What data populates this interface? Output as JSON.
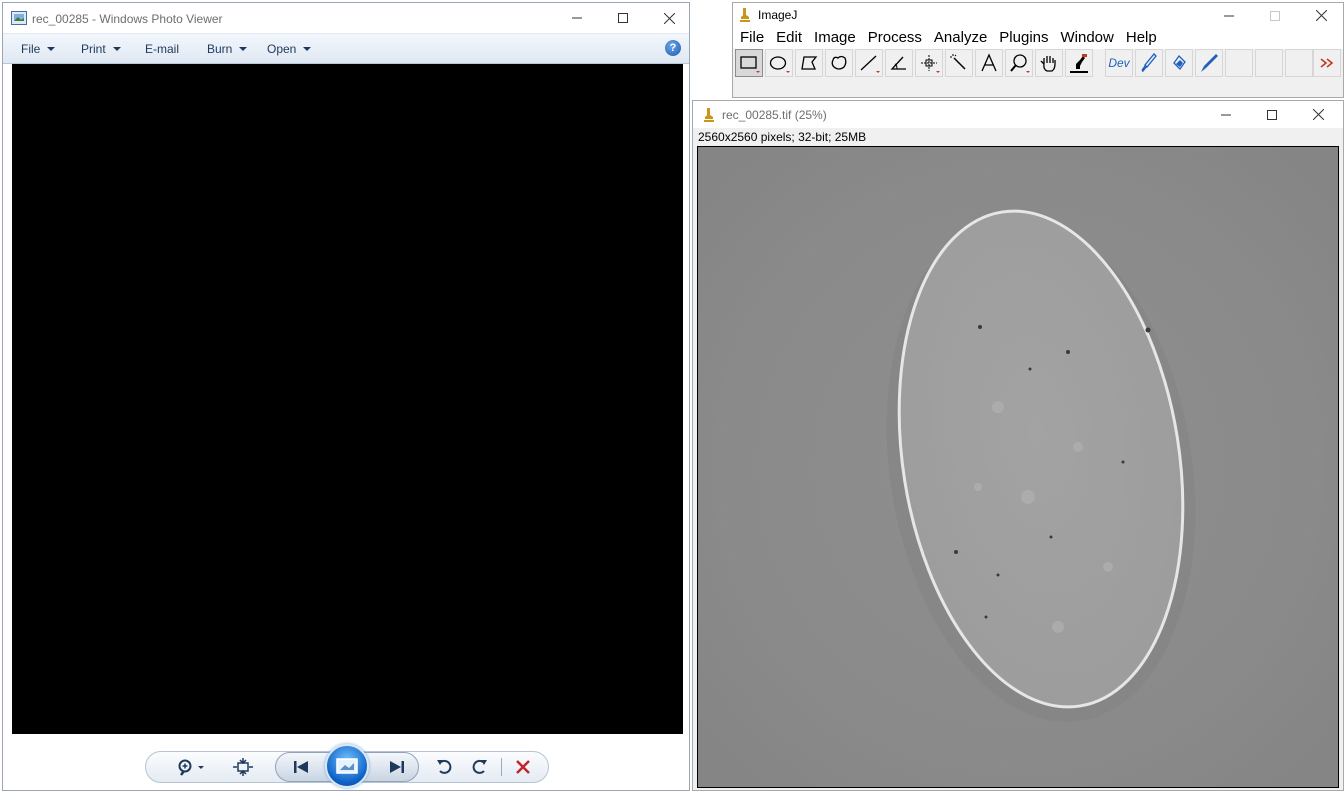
{
  "photo_viewer": {
    "title": "rec_00285 - Windows Photo Viewer",
    "menu": {
      "file": "File",
      "print": "Print",
      "email": "E-mail",
      "burn": "Burn",
      "open": "Open"
    },
    "help_label": "?",
    "icons": [
      "photo-viewer-app-icon",
      "minimize-icon",
      "maximize-icon",
      "close-icon",
      "help-icon",
      "zoom-icon",
      "fit-to-window-icon",
      "previous-icon",
      "slideshow-icon",
      "next-icon",
      "rotate-counterclockwise-icon",
      "rotate-clockwise-icon",
      "delete-icon"
    ]
  },
  "imagej": {
    "title": "ImageJ",
    "menu": {
      "file": "File",
      "edit": "Edit",
      "image": "Image",
      "process": "Process",
      "analyze": "Analyze",
      "plugins": "Plugins",
      "window": "Window",
      "help": "Help"
    },
    "tools": [
      "rectangle",
      "oval",
      "polygon",
      "freehand",
      "straight-line",
      "angle",
      "point",
      "wand",
      "text",
      "magnifier",
      "scrolling",
      "color-picker",
      "developer-menu",
      "paintbrush",
      "flood-fill",
      "pencil",
      "more-tools"
    ],
    "dev_label": "Dev",
    "colors": {
      "tool_red": "#c0392b",
      "dev_blue": "#1f5fbf"
    }
  },
  "image_window": {
    "title": "rec_00285.tif (25%)",
    "info": "2560x2560 pixels; 32-bit; 25MB",
    "colors": {
      "background_gray": "#8a8a8a",
      "specimen_gray": "#a0a0a0",
      "specimen_edge": "#e6e6e6"
    }
  }
}
